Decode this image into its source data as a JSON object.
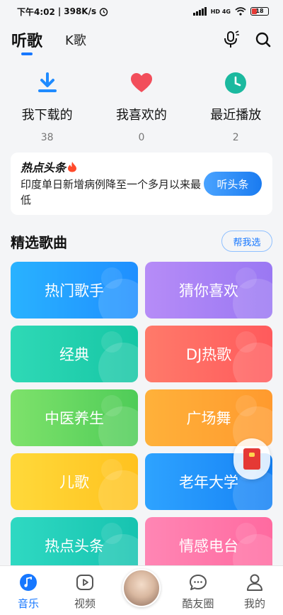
{
  "status": {
    "time": "下午4:02",
    "speed": "398K/s",
    "network": "HD 4G",
    "battery": "18"
  },
  "header": {
    "tab_active": "听歌",
    "tab_other": "K歌",
    "icons": [
      "voice-search-icon",
      "search-icon"
    ]
  },
  "quick": [
    {
      "label": "我下载的",
      "count": "38",
      "icon": "download-icon",
      "color": "#1f8bff"
    },
    {
      "label": "我喜欢的",
      "count": "0",
      "icon": "heart-icon",
      "color": "#f24e5b"
    },
    {
      "label": "最近播放",
      "count": "2",
      "icon": "clock-icon",
      "color": "#1bb99f"
    }
  ],
  "news": {
    "brand": "热点头条",
    "text": "印度单日新增病例降至一个多月以来最低",
    "button": "听头条"
  },
  "section": {
    "title": "精选歌曲",
    "pick_button": "帮我选"
  },
  "tiles": [
    {
      "label": "热门歌手",
      "from": "#29b2ff",
      "to": "#1f8fff"
    },
    {
      "label": "猜你喜欢",
      "from": "#b68cf7",
      "to": "#9a78f3"
    },
    {
      "label": "经典",
      "from": "#2fd9b6",
      "to": "#16c6a5"
    },
    {
      "label": "DJ热歌",
      "from": "#ff7a6a",
      "to": "#ff5a5c"
    },
    {
      "label": "中医养生",
      "from": "#7ee26b",
      "to": "#4fcc58"
    },
    {
      "label": "广场舞",
      "from": "#ffb13a",
      "to": "#ff9a2e"
    },
    {
      "label": "儿歌",
      "from": "#ffd93a",
      "to": "#ffc21f"
    },
    {
      "label": "老年大学",
      "from": "#2ea3ff",
      "to": "#1682f5"
    },
    {
      "label": "热点头条",
      "from": "#2fd9c2",
      "to": "#17c3b0"
    },
    {
      "label": "情感电台",
      "from": "#ff86b4",
      "to": "#ff6aa0"
    }
  ],
  "nav": [
    {
      "label": "音乐",
      "icon": "music-note-icon",
      "active": true
    },
    {
      "label": "视频",
      "icon": "video-play-icon",
      "active": false
    },
    {
      "label": "",
      "icon": "avatar",
      "active": false
    },
    {
      "label": "酷友圈",
      "icon": "chat-bubble-icon",
      "active": false
    },
    {
      "label": "我的",
      "icon": "person-icon",
      "active": false
    }
  ]
}
